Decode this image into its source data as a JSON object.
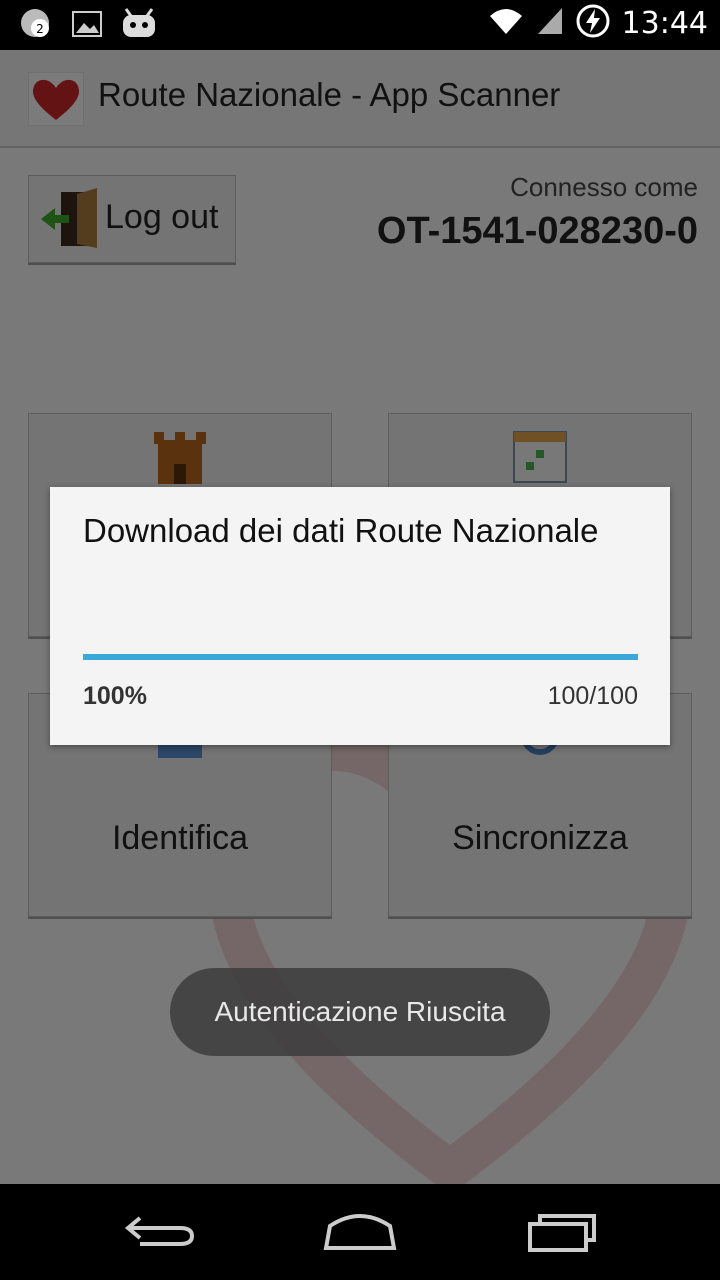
{
  "status_bar": {
    "time": "13:44",
    "notification_count": "2",
    "icons": [
      "chat-notification-icon",
      "image-icon",
      "cyanogen-icon",
      "wifi-icon",
      "signal-icon",
      "battery-charging-icon"
    ]
  },
  "app": {
    "title": "Route Nazionale - App Scanner",
    "logout_label": "Log out",
    "connected_label": "Connesso come",
    "connected_code": "OT-1541-028230-0",
    "tiles": [
      {
        "label": "",
        "icon": "castle-icon"
      },
      {
        "label": "",
        "icon": "calendar-icon"
      },
      {
        "label": "Identifica",
        "icon": "identify-icon"
      },
      {
        "label": "Sincronizza",
        "icon": "sync-icon"
      }
    ]
  },
  "dialog": {
    "title": "Download dei dati Route Nazionale",
    "percent": "100%",
    "count": "100/100",
    "progress_fraction": 1.0
  },
  "toast": {
    "text": "Autenticazione Riuscita"
  },
  "colors": {
    "progress": "#3aa8d9",
    "accent_red": "#c8272a"
  }
}
